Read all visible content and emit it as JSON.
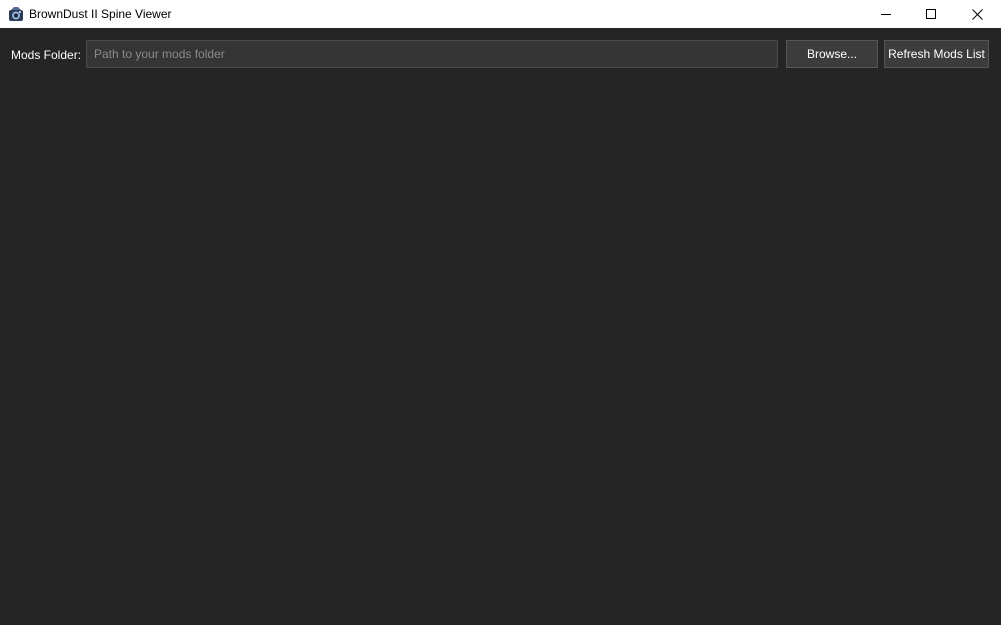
{
  "window": {
    "title": "BrownDust II Spine Viewer",
    "icon": "app-icon",
    "controls": {
      "minimize_icon": "minimize-icon",
      "maximize_icon": "maximize-icon",
      "close_icon": "close-icon"
    }
  },
  "toolbar": {
    "mods_folder_label": "Mods Folder:",
    "path_input": {
      "value": "",
      "placeholder": "Path to your mods folder"
    },
    "browse_label": "Browse...",
    "refresh_label": "Refresh Mods List"
  },
  "colors": {
    "background": "#252525",
    "titlebar": "#ffffff",
    "input_bg": "#353535",
    "button_bg": "#3c3c3c",
    "text": "#ffffff",
    "placeholder": "#8a8a8a"
  }
}
